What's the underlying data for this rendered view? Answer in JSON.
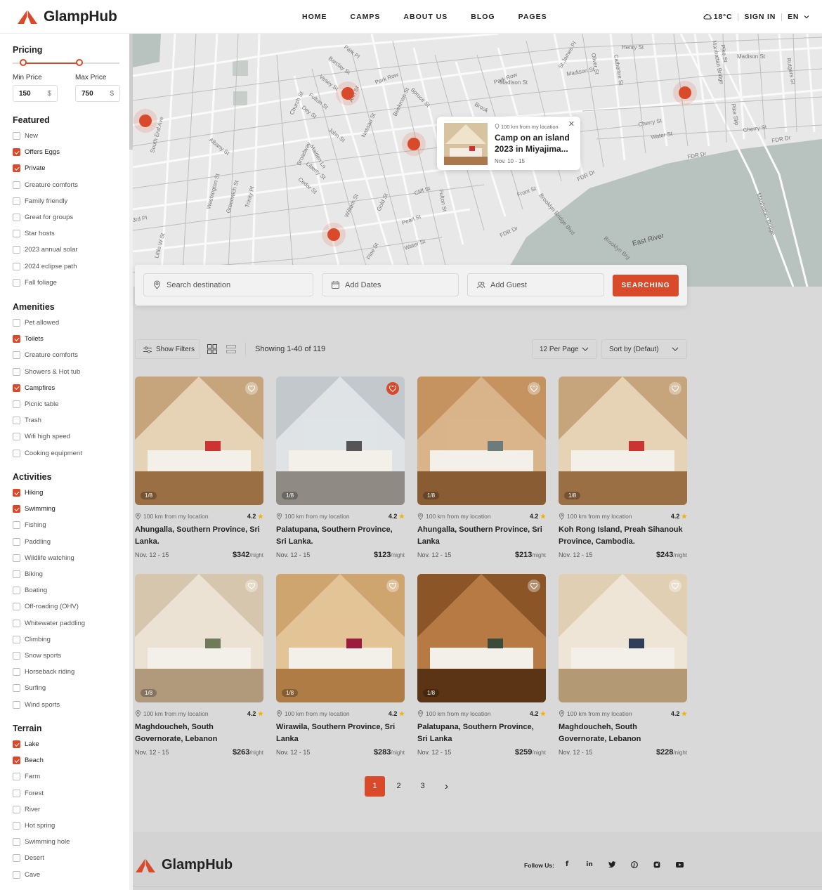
{
  "header": {
    "brand": "GlampHub",
    "nav": [
      "HOME",
      "CAMPS",
      "ABOUT US",
      "BLOG",
      "PAGES"
    ],
    "weather": "18°C",
    "sign_in": "SIGN IN",
    "lang": "EN"
  },
  "sidebar": {
    "pricing_title": "Pricing",
    "min_label": "Min Price",
    "max_label": "Max Price",
    "min_value": "150",
    "max_value": "750",
    "currency": "$",
    "slider_min_fraction": 0.1,
    "slider_max_fraction": 0.625,
    "groups": [
      {
        "title": "Featured",
        "items": [
          {
            "label": "New",
            "checked": false
          },
          {
            "label": "Offers Eggs",
            "checked": true
          },
          {
            "label": "Private",
            "checked": true
          },
          {
            "label": "Creature comforts",
            "checked": false
          },
          {
            "label": "Family friendly",
            "checked": false
          },
          {
            "label": "Great for groups",
            "checked": false
          },
          {
            "label": "Star hosts",
            "checked": false
          },
          {
            "label": "2023 annual solar",
            "checked": false
          },
          {
            "label": "2024 eclipse path",
            "checked": false
          },
          {
            "label": "Fall foliage",
            "checked": false
          }
        ]
      },
      {
        "title": "Amenities",
        "items": [
          {
            "label": "Pet allowed",
            "checked": false
          },
          {
            "label": "Toilets",
            "checked": true
          },
          {
            "label": "Creature comforts",
            "checked": false
          },
          {
            "label": "Showers & Hot tub",
            "checked": false
          },
          {
            "label": "Campfires",
            "checked": true
          },
          {
            "label": "Picnic table",
            "checked": false
          },
          {
            "label": "Trash",
            "checked": false
          },
          {
            "label": "Wifi high speed",
            "checked": false
          },
          {
            "label": "Cooking equipment",
            "checked": false
          }
        ]
      },
      {
        "title": "Activities",
        "items": [
          {
            "label": "Hiking",
            "checked": true
          },
          {
            "label": "Swimming",
            "checked": true
          },
          {
            "label": "Fishing",
            "checked": false
          },
          {
            "label": "Paddling",
            "checked": false
          },
          {
            "label": "Wildlife watching",
            "checked": false
          },
          {
            "label": "Biking",
            "checked": false
          },
          {
            "label": "Boating",
            "checked": false
          },
          {
            "label": "Off-roading (OHV)",
            "checked": false
          },
          {
            "label": "Whitewater paddling",
            "checked": false
          },
          {
            "label": "Climbing",
            "checked": false
          },
          {
            "label": "Snow sports",
            "checked": false
          },
          {
            "label": "Horseback riding",
            "checked": false
          },
          {
            "label": "Surfing",
            "checked": false
          },
          {
            "label": "Wind sports",
            "checked": false
          }
        ]
      },
      {
        "title": "Terrain",
        "items": [
          {
            "label": "Lake",
            "checked": true
          },
          {
            "label": "Beach",
            "checked": true
          },
          {
            "label": "Farm",
            "checked": false
          },
          {
            "label": "Forest",
            "checked": false
          },
          {
            "label": "River",
            "checked": false
          },
          {
            "label": "Hot spring",
            "checked": false
          },
          {
            "label": "Swimming hole",
            "checked": false
          },
          {
            "label": "Desert",
            "checked": false
          },
          {
            "label": "Cave",
            "checked": false
          }
        ]
      }
    ]
  },
  "map": {
    "streets": [
      "Park Pl",
      "Barclay St",
      "Vesey St",
      "Park Row",
      "Fulton St",
      "Dey St",
      "Church St",
      "John St",
      "Nassau St",
      "Ann St",
      "Beekman St",
      "Spruce St",
      "Madison St",
      "Henry St",
      "Oliver St",
      "Catherine St",
      "Madison St",
      "Cherry St",
      "Water St",
      "FDR Dr",
      "FDR Dr",
      "Pike Slip",
      "Manhattan Bridge",
      "Pike St",
      "Rutgers St",
      "Albany St",
      "Broadway",
      "Maiden Ln",
      "Liberty St",
      "Cedar St",
      "Gold St",
      "William St",
      "Pine St",
      "Pearl St",
      "Water St",
      "Front St",
      "Cliff St",
      "Fulton St",
      "South End Ave",
      "Washington St",
      "Greenwich St",
      "Trinity Pl",
      "Little W St",
      "3rd Pl",
      "Brooklyn Bridge Blvd",
      "FDR Dr",
      "Brooklyn Brg",
      "East River",
      "Manhattan Bridge",
      "St James Pl",
      "Brook"
    ],
    "popup": {
      "distance": "100 km from my location",
      "title": "Camp on an island 2023 in Miyajima...",
      "dates": "Nov. 10 - 15"
    }
  },
  "search": {
    "destination_placeholder": "Search destination",
    "dates_placeholder": "Add Dates",
    "guest_placeholder": "Add Guest",
    "button": "SEARCHING"
  },
  "toolbar": {
    "show_filters": "Show Filters",
    "showing": "Showing 1-40 of 119",
    "per_page": "12 Per Page",
    "sort": "Sort by (Defaut)"
  },
  "cards": [
    {
      "distance": "100 km from my location",
      "rating": "4.2",
      "title": "Ahungalla, Southern Province, Sri Lanka.",
      "dates": "Nov. 12 - 15",
      "price": "$342",
      "unit": "/night",
      "counter": "1/8",
      "liked": false
    },
    {
      "distance": "100 km from my location",
      "rating": "4.2",
      "title": "Palatupana, Southern Province, Sri Lanka.",
      "dates": "Nov. 12 - 15",
      "price": "$123",
      "unit": "/night",
      "counter": "1/8",
      "liked": true
    },
    {
      "distance": "100 km from my location",
      "rating": "4.2",
      "title": "Ahungalla, Southern Province, Sri Lanka",
      "dates": "Nov. 12 - 15",
      "price": "$213",
      "unit": "/night",
      "counter": "1/8",
      "liked": false
    },
    {
      "distance": "100 km from my location",
      "rating": "4.2",
      "title": "Koh Rong Island, Preah Sihanouk Province, Cambodia.",
      "dates": "Nov. 12 - 15",
      "price": "$243",
      "unit": "/night",
      "counter": "1/8",
      "liked": false
    },
    {
      "distance": "100 km from my location",
      "rating": "4.2",
      "title": "Maghdoucheh, South Governorate, Lebanon",
      "dates": "Nov. 12 - 15",
      "price": "$263",
      "unit": "/night",
      "counter": "1/8",
      "liked": false
    },
    {
      "distance": "100 km from my location",
      "rating": "4.2",
      "title": "Wirawila, Southern Province, Sri Lanka",
      "dates": "Nov. 12 - 15",
      "price": "$283",
      "unit": "/night",
      "counter": "1/8",
      "liked": false
    },
    {
      "distance": "100 km from my location",
      "rating": "4.2",
      "title": "Palatupana, Southern Province, Sri Lanka",
      "dates": "Nov. 12 - 15",
      "price": "$259",
      "unit": "/night",
      "counter": "1/8",
      "liked": false
    },
    {
      "distance": "100 km from my location",
      "rating": "4.2",
      "title": "Maghdoucheh, South Governorate, Lebanon",
      "dates": "Nov. 12 - 15",
      "price": "$228",
      "unit": "/night",
      "counter": "",
      "liked": false
    }
  ],
  "pagination": {
    "pages": [
      "1",
      "2",
      "3"
    ],
    "active": "1",
    "next": "›"
  },
  "footer": {
    "brand": "GlampHub",
    "follow": "Follow Us:",
    "social": [
      "f",
      "in",
      "tw",
      "p",
      "ig",
      "yt"
    ]
  },
  "colors": {
    "accent": "#d84a2a",
    "map_bg": "#e8e8e8",
    "water": "#b8c2bf",
    "page_bg": "#d9d9d9"
  }
}
